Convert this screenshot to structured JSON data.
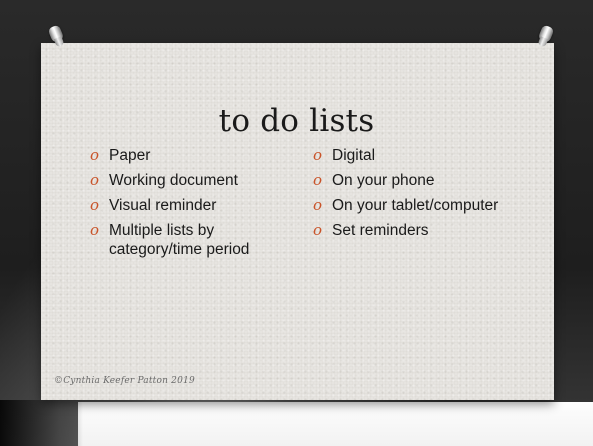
{
  "slide": {
    "title": "to do lists",
    "bullet_glyph": "o",
    "accent_color": "#c9542a",
    "left_column": [
      {
        "text": "Paper",
        "is_heading": true
      },
      {
        "text": "Working document",
        "is_heading": false
      },
      {
        "text": "Visual reminder",
        "is_heading": false
      },
      {
        "text": "Multiple lists by category/time period",
        "is_heading": false
      }
    ],
    "right_column": [
      {
        "text": "Digital",
        "is_heading": true
      },
      {
        "text": "On your phone",
        "is_heading": false
      },
      {
        "text": "On your tablet/computer",
        "is_heading": false
      },
      {
        "text": "Set reminders",
        "is_heading": false
      }
    ],
    "copyright": "©Cynthia Keefer Patton 2019"
  },
  "icons": {
    "left_pin": "pushpin-icon",
    "right_pin": "pushpin-icon"
  }
}
